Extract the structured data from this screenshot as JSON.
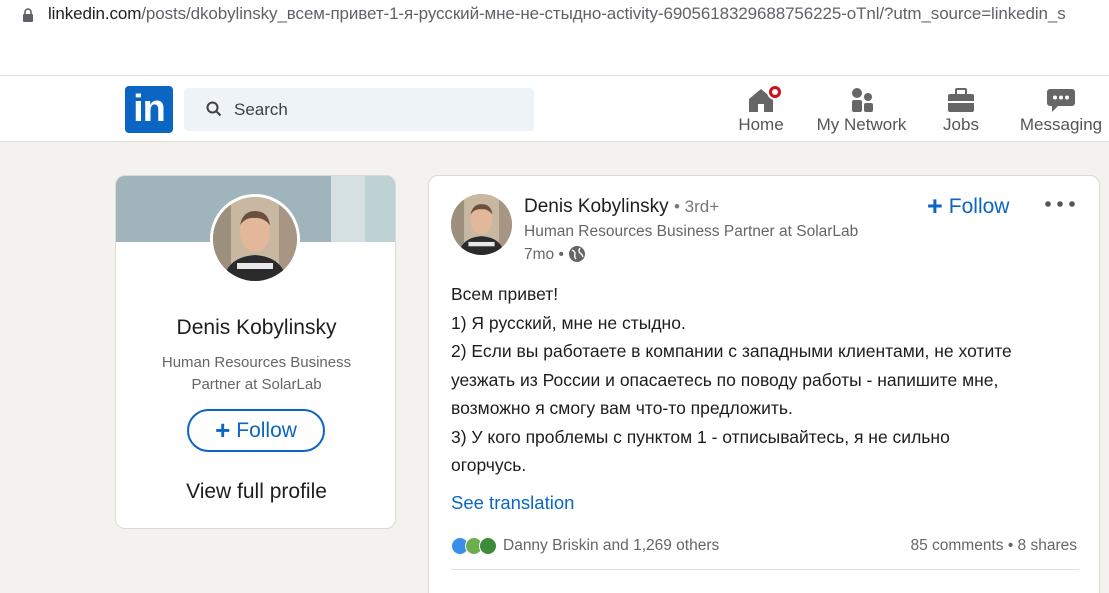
{
  "browser": {
    "url_host": "linkedin.com",
    "url_path": "/posts/dkobylinsky_всем-привет-1-я-русский-мне-не-стыдно-activity-6905618329688756225-oTnl/?utm_source=linkedin_s"
  },
  "header": {
    "logo": "in",
    "search_placeholder": "Search",
    "nav": [
      {
        "label": "Home",
        "icon": "home-icon"
      },
      {
        "label": "My Network",
        "icon": "network-icon"
      },
      {
        "label": "Jobs",
        "icon": "briefcase-icon"
      },
      {
        "label": "Messaging",
        "icon": "messaging-icon"
      }
    ]
  },
  "profile_card": {
    "name": "Denis Kobylinsky",
    "headline": "Human Resources Business Partner at SolarLab",
    "follow_label": "Follow",
    "view_profile_label": "View full profile"
  },
  "post": {
    "author": "Denis Kobylinsky",
    "degree": "• 3rd+",
    "headline": "Human Resources Business Partner at SolarLab",
    "time": "7mo •",
    "follow_label": "Follow",
    "body_lines": [
      "Всем привет!",
      "1) Я русский, мне не стыдно.",
      "2) Если вы работаете в компании с западными клиентами, не хотите",
      "уезжать из России и опасаетесь по поводу работы - напишите мне,",
      "возможно я смогу вам что-то предложить.",
      "3) У кого проблемы с пунктом 1 - отписывайтесь, я не сильно",
      "огорчусь."
    ],
    "see_translation": "See translation",
    "reactions_text": "Danny Briskin and 1,269 others",
    "stats_text": "85 comments • 8 shares"
  },
  "colors": {
    "brand_blue": "#0a66c2",
    "page_bg": "#f3f2ef",
    "notification_red": "#cc1016"
  }
}
